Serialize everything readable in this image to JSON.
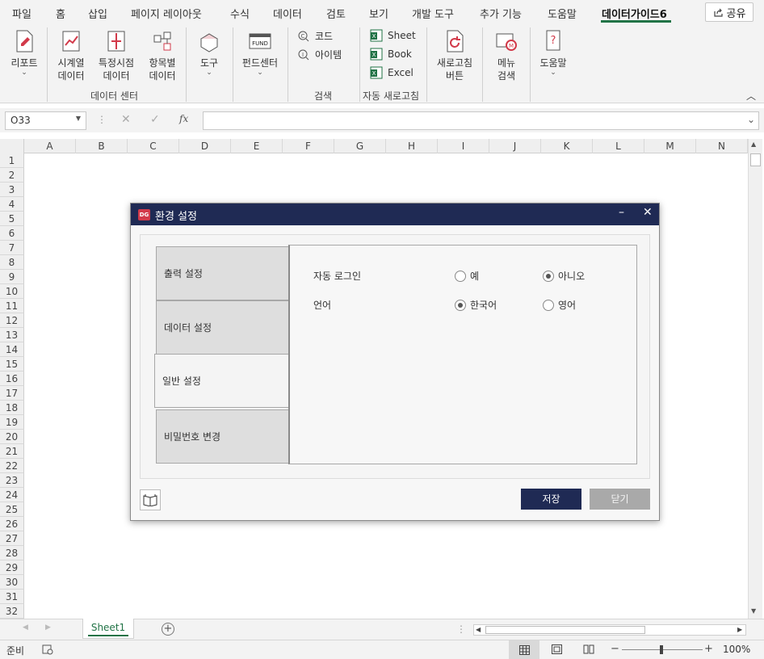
{
  "menubar": {
    "items": [
      "파일",
      "홈",
      "삽입",
      "페이지 레이아웃",
      "수식",
      "데이터",
      "검토",
      "보기",
      "개발 도구",
      "추가 기능",
      "도움말",
      "데이터가이드6"
    ],
    "share_label": "공유"
  },
  "ribbon": {
    "report_label": "리포트",
    "timeseries_label1": "시계열",
    "timeseries_label2": "데이터",
    "specific_label1": "특정시점",
    "specific_label2": "데이터",
    "item_label1": "항목별",
    "item_label2": "데이터",
    "data_center_group": "데이터 센터",
    "tools_label": "도구",
    "fund_label": "펀드센터",
    "code_label": "코드",
    "item_search_label": "아이템",
    "search_group": "검색",
    "sheet_label": "Sheet",
    "book_label": "Book",
    "excel_label": "Excel",
    "auto_refresh_group": "자동 새로고침",
    "refresh_btn_label1": "새로고침",
    "refresh_btn_label2": "버튼",
    "menu_search_label1": "메뉴",
    "menu_search_label2": "검색",
    "help_label": "도움말",
    "fund_icon_text": "FUND"
  },
  "formula_bar": {
    "name_box": "O33",
    "fx": "fx",
    "value": ""
  },
  "grid": {
    "columns": [
      "A",
      "B",
      "C",
      "D",
      "E",
      "F",
      "G",
      "H",
      "I",
      "J",
      "K",
      "L",
      "M",
      "N"
    ],
    "rows": [
      "1",
      "2",
      "3",
      "4",
      "5",
      "6",
      "7",
      "8",
      "9",
      "10",
      "11",
      "12",
      "13",
      "14",
      "15",
      "16",
      "17",
      "18",
      "19",
      "20",
      "21",
      "22",
      "23",
      "24",
      "25",
      "26",
      "27",
      "28",
      "29",
      "30",
      "31",
      "32"
    ]
  },
  "sheet_tabs": {
    "active": "Sheet1"
  },
  "status_bar": {
    "status": "준비",
    "zoom": "100%"
  },
  "dialog": {
    "title": "환경 설정",
    "logo": "DG",
    "tabs": [
      "출력 설정",
      "데이터 설정",
      "일반 설정",
      "비밀번호 변경"
    ],
    "selected_tab": "일반 설정",
    "options": {
      "auto_login": {
        "label": "자동 로그인",
        "yes": "예",
        "no": "아니오",
        "selected": "아니오"
      },
      "language": {
        "label": "언어",
        "korean": "한국어",
        "english": "영어",
        "selected": "한국어"
      }
    },
    "save_label": "저장",
    "close_label": "닫기"
  },
  "colors": {
    "accent": "#217346",
    "dialog_title": "#1f2a54",
    "save_button": "#1f2a54",
    "logo": "#d23a4a"
  }
}
